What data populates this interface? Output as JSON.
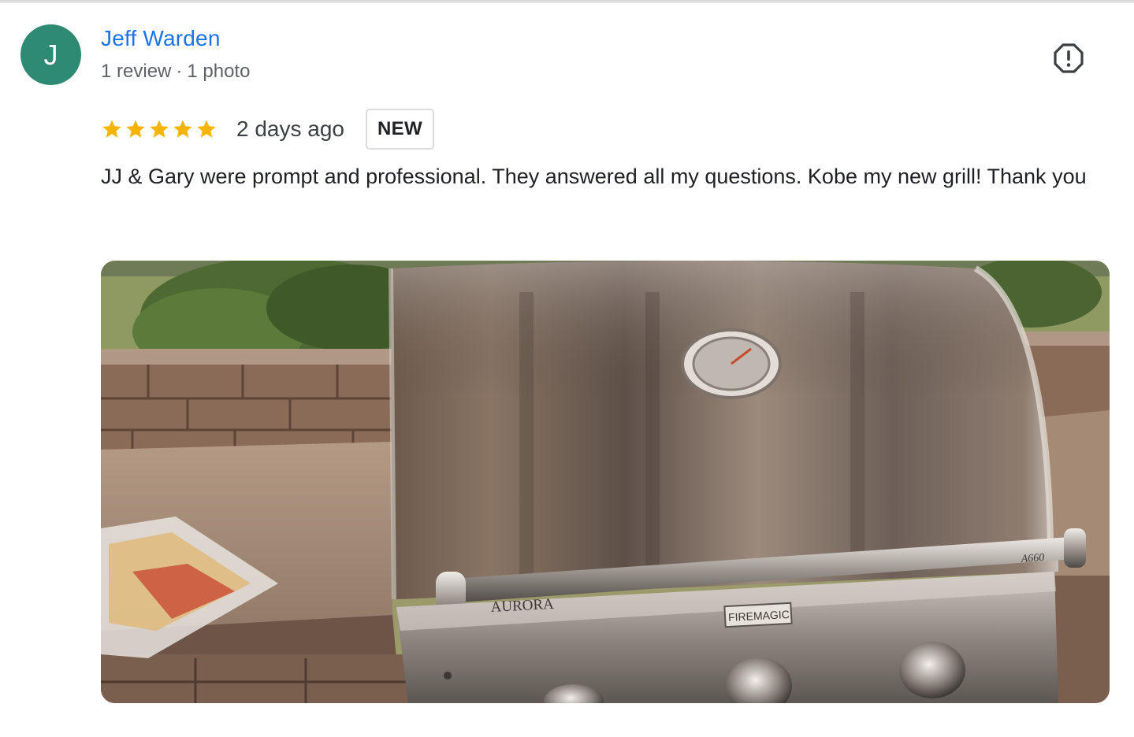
{
  "reviewer": {
    "initial": "J",
    "avatar_color": "#2f8a73",
    "name": "Jeff Warden",
    "review_count": "1 review",
    "separator": "·",
    "photo_count": "1 photo"
  },
  "review": {
    "rating": 5,
    "max_rating": 5,
    "date": "2 days ago",
    "badge": "NEW",
    "text": "JJ & Gary were prompt and professional. They answered all my questions. Kobe my new grill! Thank you"
  },
  "photo": {
    "brand": "AURORA",
    "logo": "FIREMAGIC",
    "model": "A660"
  },
  "icons": {
    "report": "report-flag-icon",
    "star": "star-icon"
  },
  "colors": {
    "name_link": "#1a73e8",
    "star": "#f6b400",
    "meta_text": "#5f6368"
  }
}
